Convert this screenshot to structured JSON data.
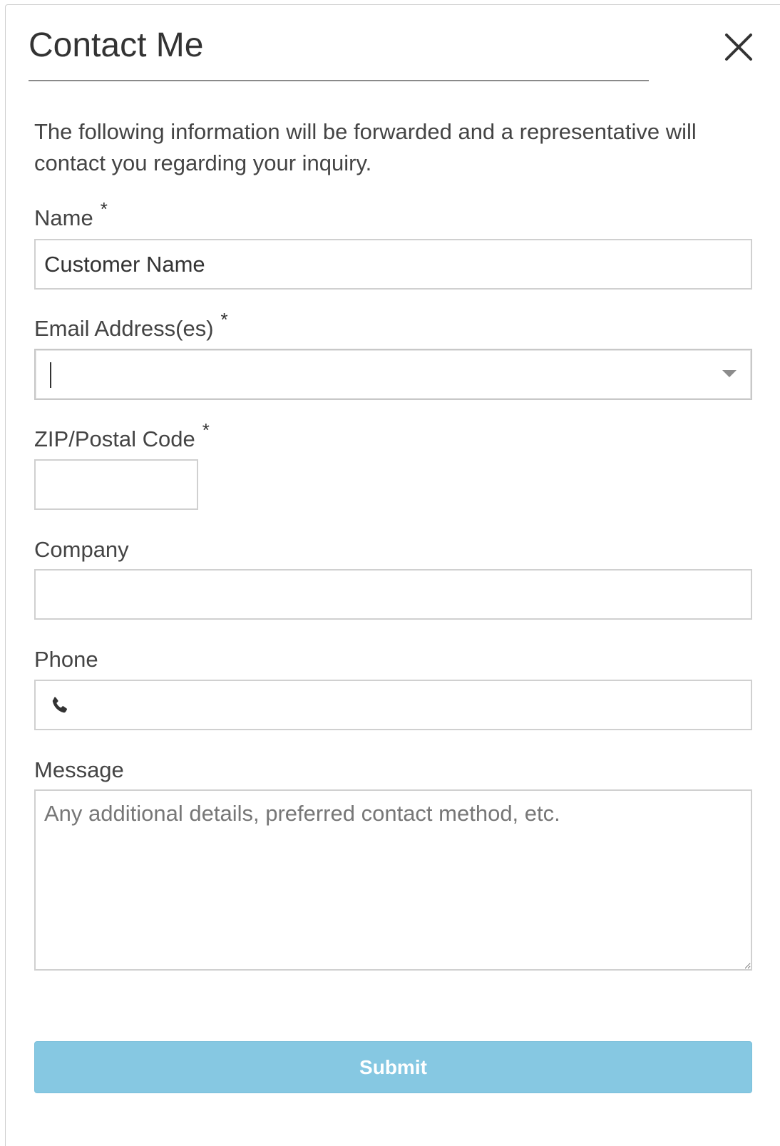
{
  "dialog": {
    "title": "Contact Me",
    "close_icon": "close-icon",
    "intro": "The following information will be forwarded and a representative will contact you regarding your inquiry."
  },
  "fields": {
    "name": {
      "label": "Name",
      "required_mark": "*",
      "value": "Customer Name"
    },
    "email": {
      "label": "Email Address(es)",
      "required_mark": "*",
      "value": "",
      "dropdown_icon": "chevron-down-icon"
    },
    "zip": {
      "label": "ZIP/Postal Code",
      "required_mark": "*",
      "value": ""
    },
    "company": {
      "label": "Company",
      "value": ""
    },
    "phone": {
      "label": "Phone",
      "value": "",
      "icon": "phone-icon"
    },
    "message": {
      "label": "Message",
      "value": "",
      "placeholder": "Any additional details, preferred contact method, etc."
    }
  },
  "actions": {
    "submit_label": "Submit",
    "submit_color": "#86c8e2"
  }
}
